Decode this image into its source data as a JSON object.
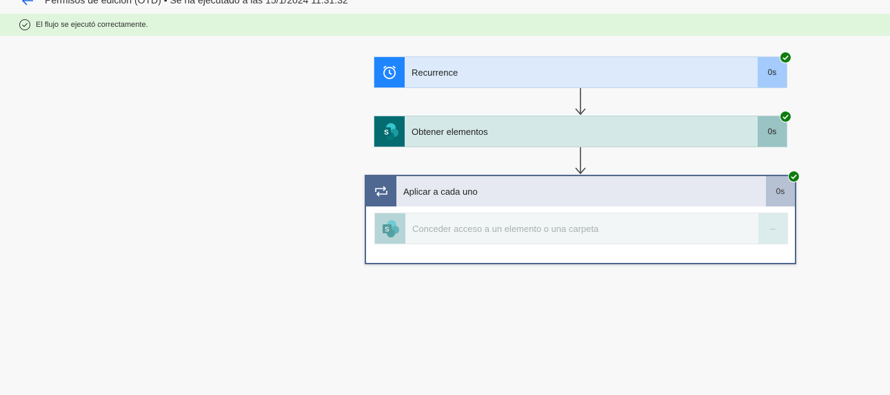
{
  "header": {
    "title": "Permisos de edición (OTD) • Se ha ejecutado a las 15/1/2024 11:31:32"
  },
  "banner": {
    "message": "El flujo se ejecutó correctamente."
  },
  "steps": [
    {
      "label": "Recurrence",
      "duration": "0s",
      "status": "succeeded"
    },
    {
      "label": "Obtener elementos",
      "duration": "0s",
      "status": "succeeded"
    },
    {
      "label": "Aplicar a cada uno",
      "duration": "0s",
      "status": "succeeded"
    }
  ],
  "loop_children": [
    {
      "label": "Conceder acceso a un elemento o una carpeta",
      "duration": "--",
      "status": "not-run"
    }
  ],
  "colors": {
    "success": "#107c10",
    "recurrence": "#1f85ff",
    "sharepoint": "#036c70",
    "loop": "#4e6891"
  }
}
